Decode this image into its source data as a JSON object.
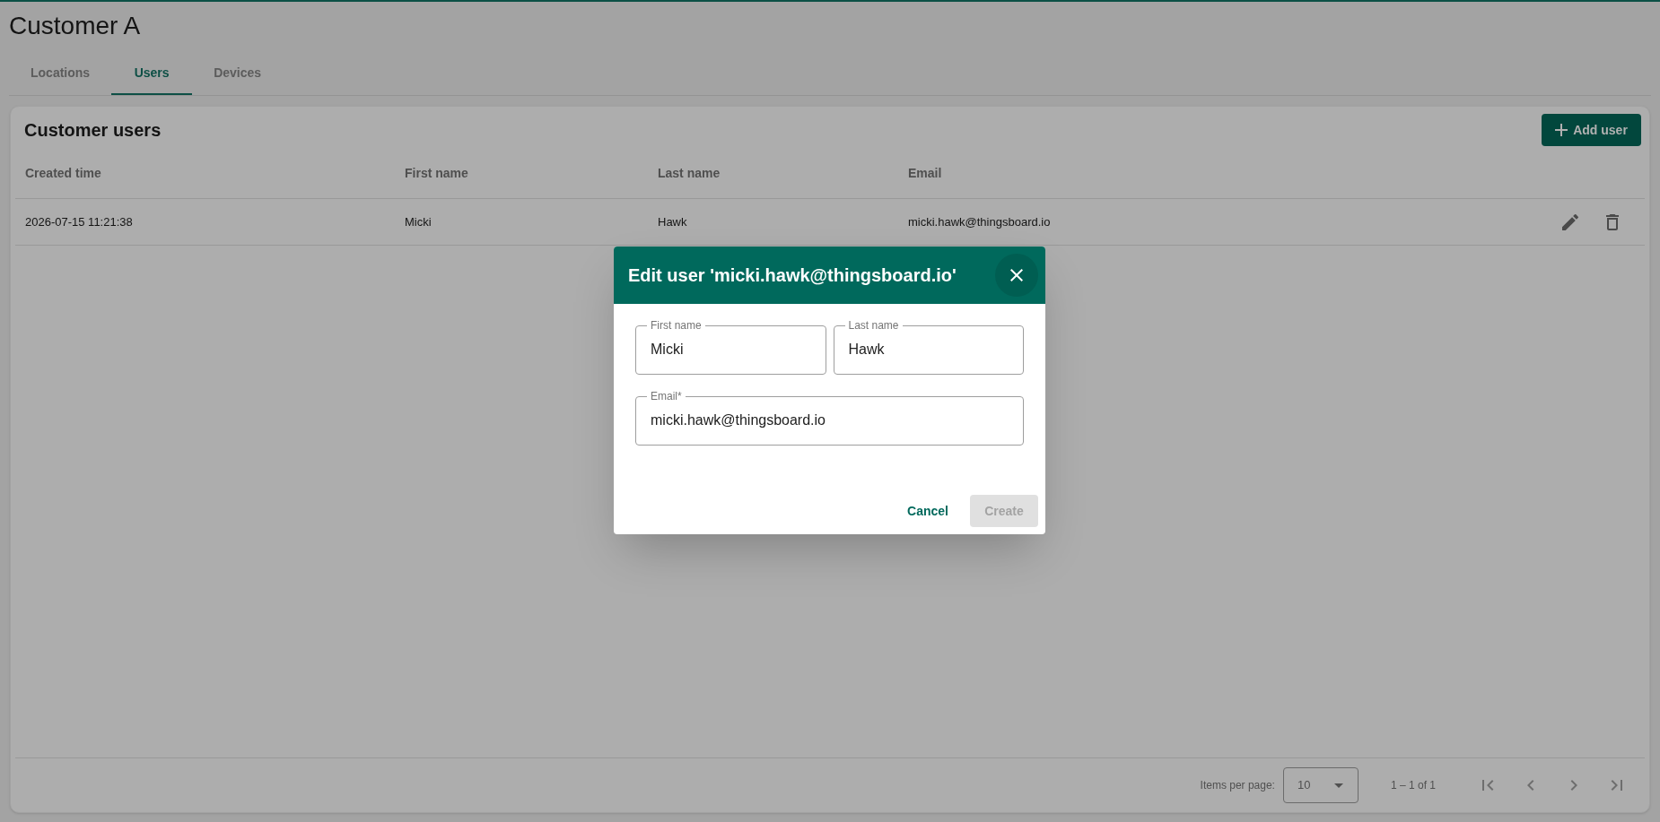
{
  "page": {
    "title": "Customer A"
  },
  "tabs": [
    {
      "label": "Locations",
      "selected": false
    },
    {
      "label": "Users",
      "selected": true
    },
    {
      "label": "Devices",
      "selected": false
    }
  ],
  "card": {
    "title": "Customer users",
    "add_button": "Add user"
  },
  "table": {
    "columns": [
      "Created time",
      "First name",
      "Last name",
      "Email"
    ],
    "rows": [
      {
        "cells": [
          "2026-07-15 11:21:38",
          "Micki",
          "Hawk",
          "micki.hawk@thingsboard.io"
        ]
      }
    ]
  },
  "paginator": {
    "items_per_page_label": "Items per page:",
    "page_size": "10",
    "range": "1 – 1 of 1"
  },
  "dialog": {
    "title": "Edit user 'micki.hawk@thingsboard.io'",
    "fields": [
      {
        "label": "First name",
        "value": "Micki"
      },
      {
        "label": "Last name",
        "value": "Hawk"
      },
      {
        "label": "Email*",
        "value": "micki.hawk@thingsboard.io"
      }
    ],
    "cancel": "Cancel",
    "submit": {
      "label": "Create",
      "disabled": true
    }
  }
}
